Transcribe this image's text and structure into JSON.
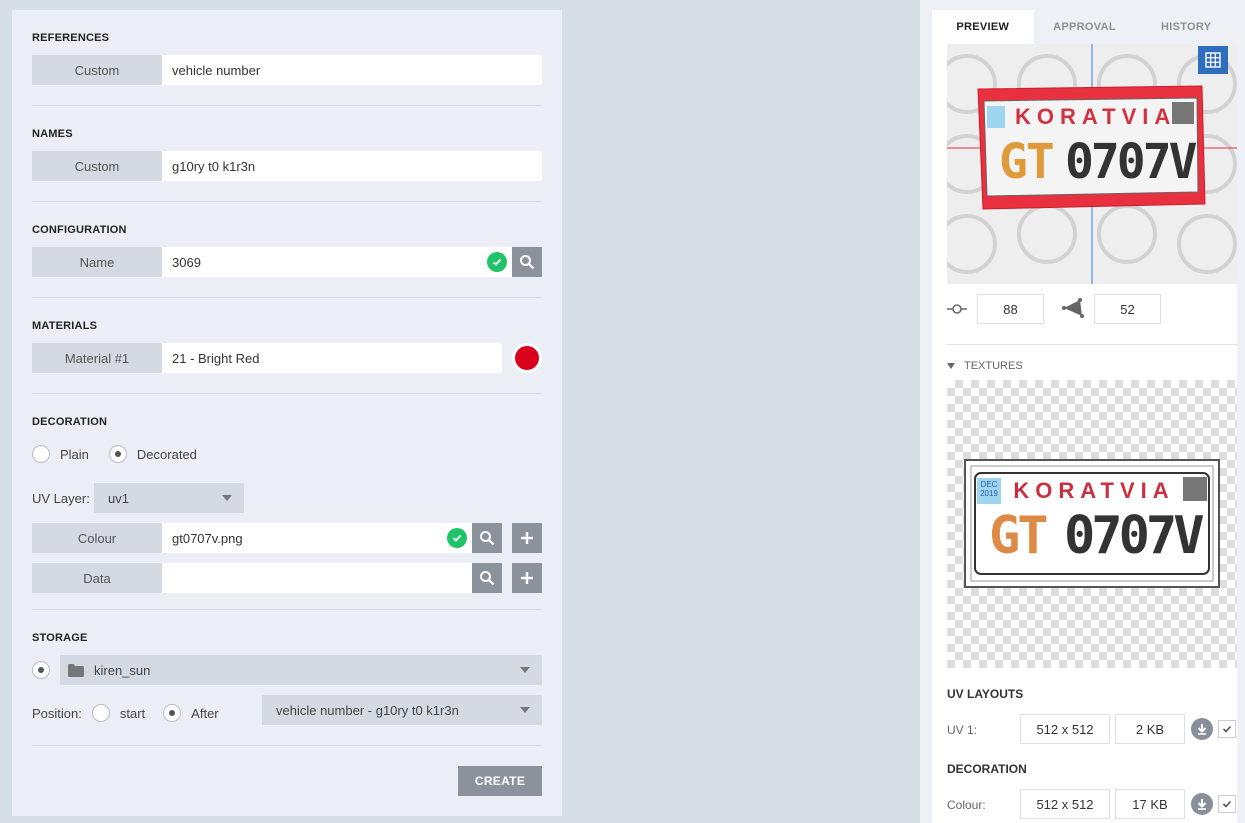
{
  "references": {
    "title": "REFERENCES",
    "label": "Custom",
    "value": "vehicle number"
  },
  "names": {
    "title": "NAMES",
    "label": "Custom",
    "value": "g10ry t0 k1r3n"
  },
  "configuration": {
    "title": "CONFIGURATION",
    "label": "Name",
    "value": "3069"
  },
  "materials": {
    "title": "MATERIALS",
    "label": "Material #1",
    "value": "21 - Bright Red",
    "swatch_color": "#d9001b"
  },
  "decoration": {
    "title": "DECORATION",
    "radio_plain": "Plain",
    "radio_decorated": "Decorated",
    "uv_layer_label": "UV Layer:",
    "uv_layer_value": "uv1",
    "colour_label": "Colour",
    "colour_value": "gt0707v.png",
    "data_label": "Data",
    "data_value": ""
  },
  "storage": {
    "title": "STORAGE",
    "folder": "kiren_sun",
    "position_label": "Position:",
    "radio_start": "start",
    "radio_after": "After",
    "after_value": "vehicle number - g10ry t0 k1r3n"
  },
  "create_label": "CREATE",
  "panel": {
    "tabs": [
      "PREVIEW",
      "APPROVAL",
      "HISTORY"
    ],
    "plate": {
      "top_text": "KORATVIA",
      "left_text": "GT",
      "right_text": "0707V",
      "badge_top": "DEC",
      "badge_bottom": "2019"
    },
    "stat_vertices": "88",
    "stat_polys": "52",
    "textures_title": "TEXTURES",
    "uv_layouts_title": "UV LAYOUTS",
    "uv1_label": "UV 1:",
    "uv1_size": "512 x 512",
    "uv1_kb": "2 KB",
    "decoration_title": "DECORATION",
    "colour_label": "Colour:",
    "colour_size": "512 x 512",
    "colour_kb": "17 KB"
  },
  "colors": {
    "accent_blue": "#2f6dbf",
    "check_green": "#21c36a",
    "plate_red": "#e8303f",
    "gt_orange": "#e09a3a"
  }
}
